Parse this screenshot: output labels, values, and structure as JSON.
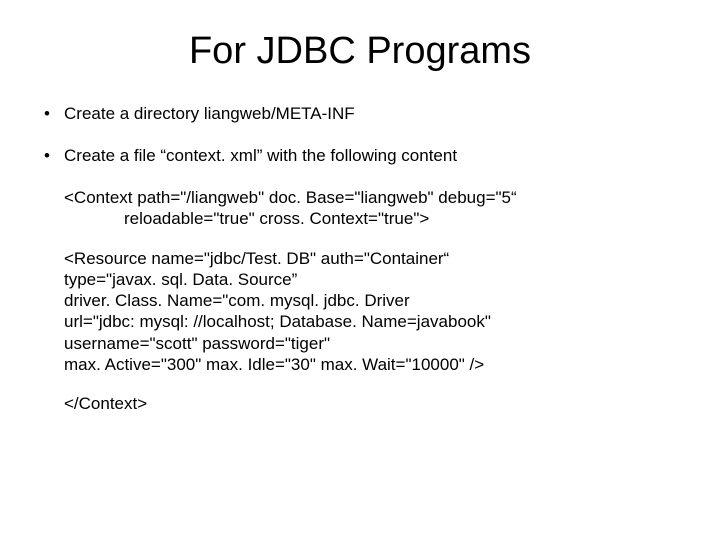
{
  "title": "For JDBC Programs",
  "bullets": {
    "b1": "Create a directory liangweb/META-INF",
    "b2": "Create a file “context. xml” with the following content"
  },
  "code": {
    "context_open_l1": "<Context path=\"/liangweb\" doc. Base=\"liangweb\" debug=\"5“",
    "context_open_l2": "reloadable=\"true\" cross. Context=\"true\">",
    "resource_l1": "<Resource name=\"jdbc/Test. DB\" auth=\"Container“",
    "resource_l2": "type=\"javax. sql. Data. Source”",
    "resource_l3": "driver. Class. Name=\"com. mysql. jdbc. Driver",
    "resource_l4": "url=\"jdbc: mysql: //localhost; Database. Name=javabook\"",
    "resource_l5": "username=\"scott\" password=\"tiger\"",
    "resource_l6": "max. Active=\"300\" max. Idle=\"30\" max. Wait=\"10000\" />",
    "context_close": "</Context>"
  }
}
